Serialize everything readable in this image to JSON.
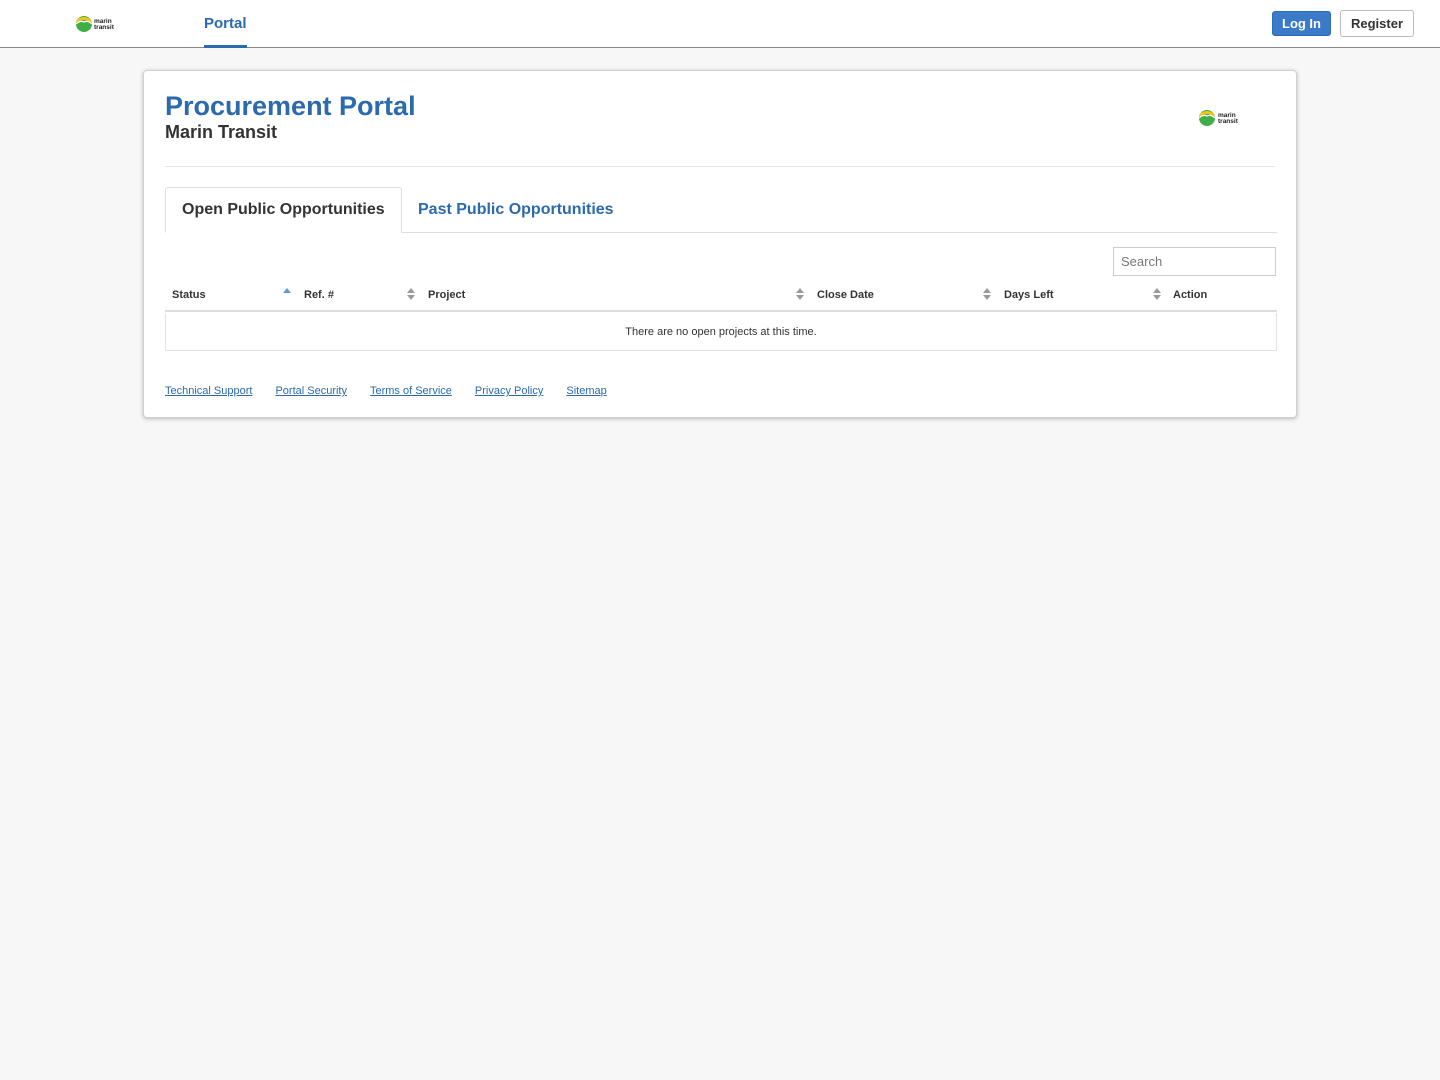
{
  "nav": {
    "tab_label": "Portal",
    "login_label": "Log In",
    "register_label": "Register"
  },
  "header": {
    "title": "Procurement Portal",
    "subtitle": "Marin Transit",
    "logo_text_line1": "marin",
    "logo_text_line2": "transit"
  },
  "tabs": [
    {
      "label": "Open Public Opportunities",
      "active": true
    },
    {
      "label": "Past Public Opportunities",
      "active": false
    }
  ],
  "search": {
    "placeholder": "Search"
  },
  "table": {
    "columns": [
      "Status",
      "Ref. #",
      "Project",
      "Close Date",
      "Days Left",
      "Action"
    ],
    "empty_message": "There are no open projects at this time."
  },
  "footer": {
    "links": [
      "Technical Support",
      "Portal Security",
      "Terms of Service",
      "Privacy Policy",
      "Sitemap"
    ]
  },
  "colors": {
    "brand_blue": "#2a6aad",
    "logo_green": "#3fae49",
    "logo_yellow": "#f2c319"
  }
}
